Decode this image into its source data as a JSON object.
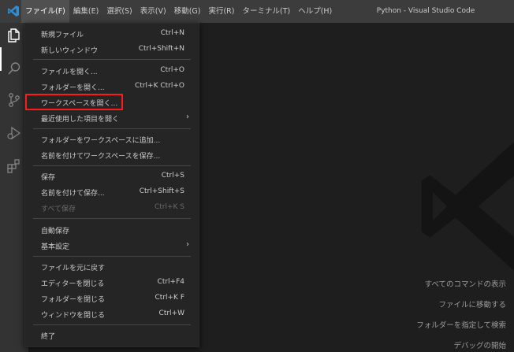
{
  "titlebar": {
    "window_title": "Python - Visual Studio Code",
    "menus": [
      {
        "label": "ファイル(F)"
      },
      {
        "label": "編集(E)"
      },
      {
        "label": "選択(S)"
      },
      {
        "label": "表示(V)"
      },
      {
        "label": "移動(G)"
      },
      {
        "label": "実行(R)"
      },
      {
        "label": "ターミナル(T)"
      },
      {
        "label": "ヘルプ(H)"
      }
    ],
    "active_menu": "ファイル(F)"
  },
  "activitybar": {
    "icons": [
      "explorer-icon",
      "search-icon",
      "source-control-icon",
      "run-debug-icon",
      "extensions-icon"
    ],
    "active": "explorer-icon"
  },
  "file_menu": {
    "items": [
      {
        "label": "新規ファイル",
        "shortcut": "Ctrl+N"
      },
      {
        "label": "新しいウィンドウ",
        "shortcut": "Ctrl+Shift+N"
      },
      {
        "label": "ファイルを開く...",
        "shortcut": "Ctrl+O"
      },
      {
        "label": "フォルダーを開く...",
        "shortcut": "Ctrl+K Ctrl+O"
      },
      {
        "label": "ワークスペースを開く...",
        "shortcut": ""
      },
      {
        "label": "最近使用した項目を開く",
        "shortcut": "",
        "submenu": true
      },
      {
        "label": "フォルダーをワークスペースに追加...",
        "shortcut": ""
      },
      {
        "label": "名前を付けてワークスペースを保存...",
        "shortcut": ""
      },
      {
        "label": "保存",
        "shortcut": "Ctrl+S"
      },
      {
        "label": "名前を付けて保存...",
        "shortcut": "Ctrl+Shift+S"
      },
      {
        "label": "すべて保存",
        "shortcut": "Ctrl+K S",
        "disabled": true
      },
      {
        "label": "自動保存",
        "shortcut": ""
      },
      {
        "label": "基本設定",
        "shortcut": "",
        "submenu": true
      },
      {
        "label": "ファイルを元に戻す",
        "shortcut": ""
      },
      {
        "label": "エディターを閉じる",
        "shortcut": "Ctrl+F4"
      },
      {
        "label": "フォルダーを閉じる",
        "shortcut": "Ctrl+K F"
      },
      {
        "label": "ウィンドウを閉じる",
        "shortcut": "Ctrl+W"
      },
      {
        "label": "終了",
        "shortcut": ""
      }
    ],
    "highlighted_item": "ワークスペースを開く..."
  },
  "editor_hints": [
    "すべてのコマンドの表示",
    "ファイルに移動する",
    "フォルダーを指定して検索",
    "デバッグの開始"
  ],
  "colors": {
    "titlebar": "#3c3c3c",
    "activitybar": "#333333",
    "editor": "#1e1e1e",
    "menu": "#252526",
    "highlight": "#ff1a1a",
    "vscode_blue": "#2c8fd8"
  }
}
